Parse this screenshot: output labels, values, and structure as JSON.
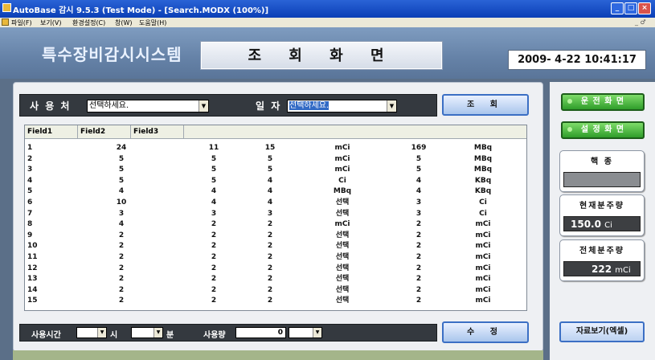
{
  "window": {
    "title": "AutoBase 감시 9.5.3 (Test Mode) - [Search.MODX (100%)]",
    "controls": [
      "_",
      "□",
      "×"
    ]
  },
  "menu": {
    "items": [
      "파일(F)",
      "보기(V)",
      "환경설정(C)",
      "창(W)",
      "도움말(H)"
    ],
    "doc_controls": "_ ♂"
  },
  "header": {
    "system_name": "특수장비감시시스템",
    "screen_name": "조 회 화 면",
    "clock": "2009- 4-22   10:41:17"
  },
  "search": {
    "user_label": "사 용 처",
    "user_value": "선택하세요.",
    "date_label": "일 자",
    "date_value": "선택하세요.",
    "query_button": "조 회"
  },
  "grid": {
    "headers": [
      "Field1",
      "Field2",
      "Field3"
    ],
    "rows": [
      [
        "1",
        "24",
        "11",
        "15",
        "mCi",
        "169",
        "MBq"
      ],
      [
        "2",
        "5",
        "5",
        "5",
        "mCi",
        "5",
        "MBq"
      ],
      [
        "3",
        "5",
        "5",
        "5",
        "mCi",
        "5",
        "MBq"
      ],
      [
        "4",
        "5",
        "5",
        "4",
        "Ci",
        "4",
        "KBq"
      ],
      [
        "5",
        "4",
        "4",
        "4",
        "MBq",
        "4",
        "KBq"
      ],
      [
        "6",
        "10",
        "4",
        "4",
        "선택",
        "3",
        "Ci"
      ],
      [
        "7",
        "3",
        "3",
        "3",
        "선택",
        "3",
        "Ci"
      ],
      [
        "8",
        "4",
        "2",
        "2",
        "mCi",
        "2",
        "mCi"
      ],
      [
        "9",
        "2",
        "2",
        "2",
        "선택",
        "2",
        "mCi"
      ],
      [
        "10",
        "2",
        "2",
        "2",
        "선택",
        "2",
        "mCi"
      ],
      [
        "11",
        "2",
        "2",
        "2",
        "선택",
        "2",
        "mCi"
      ],
      [
        "12",
        "2",
        "2",
        "2",
        "선택",
        "2",
        "mCi"
      ],
      [
        "13",
        "2",
        "2",
        "2",
        "선택",
        "2",
        "mCi"
      ],
      [
        "14",
        "2",
        "2",
        "2",
        "선택",
        "2",
        "mCi"
      ],
      [
        "15",
        "2",
        "2",
        "2",
        "선택",
        "2",
        "mCi"
      ]
    ]
  },
  "bottom": {
    "usage_time_label": "사용시간",
    "hour_label": "시",
    "minute_label": "분",
    "usage_amount_label": "사용량",
    "usage_amount_value": "0",
    "edit_button": "수 정"
  },
  "side": {
    "operation_button": "운 전 화 면",
    "settings_button": "설 정 화 면",
    "nuclide_label": "핵 종",
    "nuclide_value": "",
    "current_dist_label": "현재분주량",
    "current_dist_value": "150.0",
    "current_dist_unit": "Ci",
    "total_dist_label": "전체분주량",
    "total_dist_value": "222",
    "total_dist_unit": "mCi",
    "excel_button": "자료보기(엑셀)"
  }
}
